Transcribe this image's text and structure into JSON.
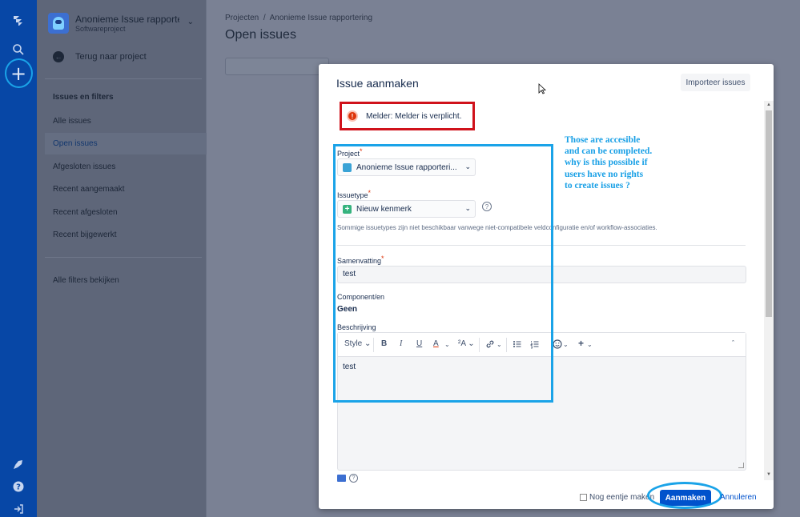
{
  "project": {
    "title": "Anonieme Issue rapporteri...",
    "subtitle": "Softwareproject"
  },
  "sidebar": {
    "back_label": "Terug naar project",
    "section_title": "Issues en filters",
    "items": [
      {
        "label": "Alle issues"
      },
      {
        "label": "Open issues"
      },
      {
        "label": "Afgesloten issues"
      },
      {
        "label": "Recent aangemaakt"
      },
      {
        "label": "Recent afgesloten"
      },
      {
        "label": "Recent bijgewerkt"
      }
    ],
    "all_filters_label": "Alle filters bekijken"
  },
  "main": {
    "breadcrumb_root": "Projecten",
    "breadcrumb_sep": "/",
    "breadcrumb_project": "Anonieme Issue rapportering",
    "page_title": "Open issues"
  },
  "modal": {
    "title": "Issue aanmaken",
    "import_label": "Importeer issues",
    "error_text": "Melder: Melder is verplicht.",
    "project_label": "Project",
    "project_value": "Anonieme Issue rapporteri...",
    "issuetype_label": "Issuetype",
    "issuetype_value": "Nieuw kenmerk",
    "issuetype_hint": "Sommige issuetypes zijn niet beschikbaar vanwege niet-compatibele veldconfiguratie en/of workflow-associaties.",
    "summary_label": "Samenvatting",
    "summary_value": "test",
    "component_label": "Component/en",
    "component_value": "Geen",
    "description_label": "Beschrijving",
    "description_value": "test",
    "toolbar": {
      "style_label": "Style",
      "bold": "B",
      "italic": "I",
      "underline": "U",
      "text_color": "A",
      "text_size": "²A",
      "link": "🔗"
    },
    "required_mark": "*",
    "another_label": "Nog eentje maken",
    "create_label": "Aanmaken",
    "cancel_label": "Annuleren"
  },
  "annotation": {
    "text": "Those are accesible and can be completed. why is this possible if users have no rights to create issues ?"
  },
  "colors": {
    "nav_blue": "#0747a6",
    "annotation_blue": "#1aa3e8",
    "error_red": "#d0121b",
    "primary_button": "#0052cc"
  }
}
